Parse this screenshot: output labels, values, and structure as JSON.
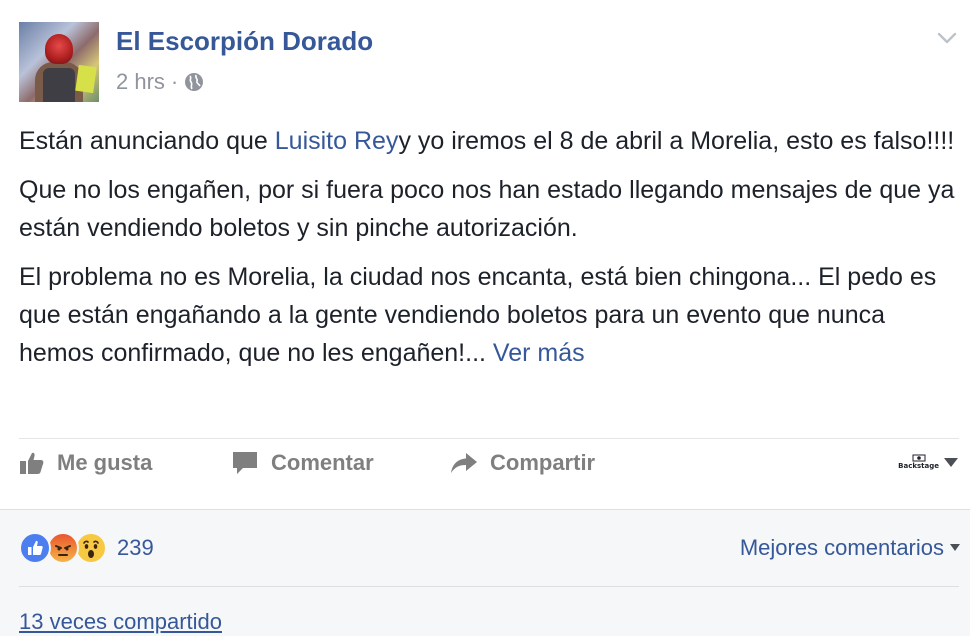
{
  "post": {
    "author": "El Escorpión Dorado",
    "time": "2 hrs",
    "separator": "·",
    "p1_before": "Están anunciando que ",
    "p1_link": "Luisito Rey",
    "p1_after": "y yo iremos el 8 de abril a Morelia, esto es falso!!!!",
    "p2": "Que no los engañen, por si fuera poco nos han estado llegando mensajes de que ya están vendiendo boletos y sin pinche autorización.",
    "p3": "El problema no es Morelia, la ciudad nos encanta, está bien chingona... El pedo es que están engañando a la gente vendiendo boletos para un evento que nunca hemos confirmado, que no les engañen!... ",
    "see_more": "Ver más"
  },
  "actions": {
    "like": "Me gusta",
    "comment": "Comentar",
    "share": "Compartir",
    "backstage": "Backstage"
  },
  "footer": {
    "reaction_count": "239",
    "sort_label": "Mejores comentarios",
    "shares": "13 veces compartido"
  },
  "icons": {
    "avatar": "profile-photo",
    "globe": "globe-icon",
    "chevron": "chevron-down-icon",
    "like": "thumbs-up-icon",
    "comment": "speech-bubble-icon",
    "share": "share-arrow-icon",
    "reactions": [
      "like-reaction-icon",
      "angry-reaction-icon",
      "wow-reaction-icon"
    ]
  },
  "colors": {
    "link": "#365899",
    "text": "#1d2129",
    "muted": "#90949c",
    "action": "#7f7f7f",
    "footer_bg": "#f6f7f9"
  }
}
